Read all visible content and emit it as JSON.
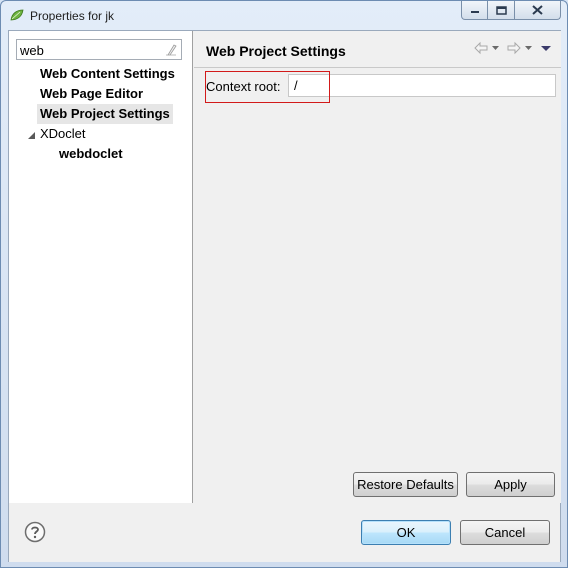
{
  "window": {
    "title": "Properties for jk"
  },
  "filter": {
    "value": "web"
  },
  "tree": {
    "items": [
      {
        "label": "Web Content Settings"
      },
      {
        "label": "Web Page Editor"
      },
      {
        "label": "Web Project Settings"
      },
      {
        "label": "XDoclet"
      },
      {
        "label": "webdoclet"
      }
    ]
  },
  "page": {
    "title": "Web Project Settings",
    "context_root_label": "Context root:",
    "context_root_value": "/"
  },
  "buttons": {
    "restore_defaults": "Restore Defaults",
    "apply": "Apply",
    "ok": "OK",
    "cancel": "Cancel"
  },
  "colors": {
    "highlight": "#d21a1a",
    "default_button_border": "#3c7fb1"
  }
}
